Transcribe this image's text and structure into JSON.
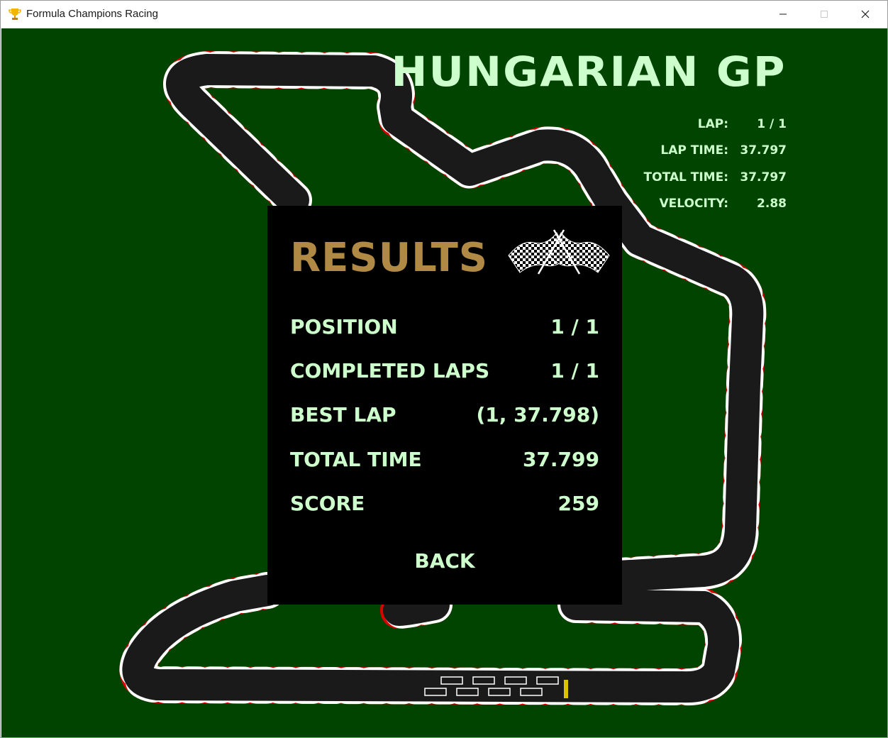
{
  "window": {
    "title": "Formula Champions Racing",
    "icon": "trophy-icon"
  },
  "hud": {
    "gp_title": "HUNGARIAN GP",
    "lap_label": "LAP:",
    "lap_value": "1 / 1",
    "lap_time_label": "LAP TIME:",
    "lap_time_value": "37.797",
    "total_time_label": "TOTAL TIME:",
    "total_time_value": "37.797",
    "velocity_label": "VELOCITY:",
    "velocity_value": "2.88"
  },
  "results": {
    "title": "RESULTS",
    "icon": "checkered-flags-icon",
    "rows": [
      {
        "label": "POSITION",
        "value": "1 / 1"
      },
      {
        "label": "COMPLETED LAPS",
        "value": "1 / 1"
      },
      {
        "label": "BEST LAP",
        "value": "(1, 37.798)"
      },
      {
        "label": "TOTAL TIME",
        "value": "37.799"
      },
      {
        "label": "SCORE",
        "value": "259"
      }
    ],
    "back_label": "BACK"
  },
  "colors": {
    "background": "#004400",
    "hud_text": "#ccffcc",
    "results_title": "#b08a44",
    "panel": "#000000",
    "track": "#1a1a1a",
    "kerb_red": "#dd0000",
    "kerb_white": "#ffffff"
  }
}
